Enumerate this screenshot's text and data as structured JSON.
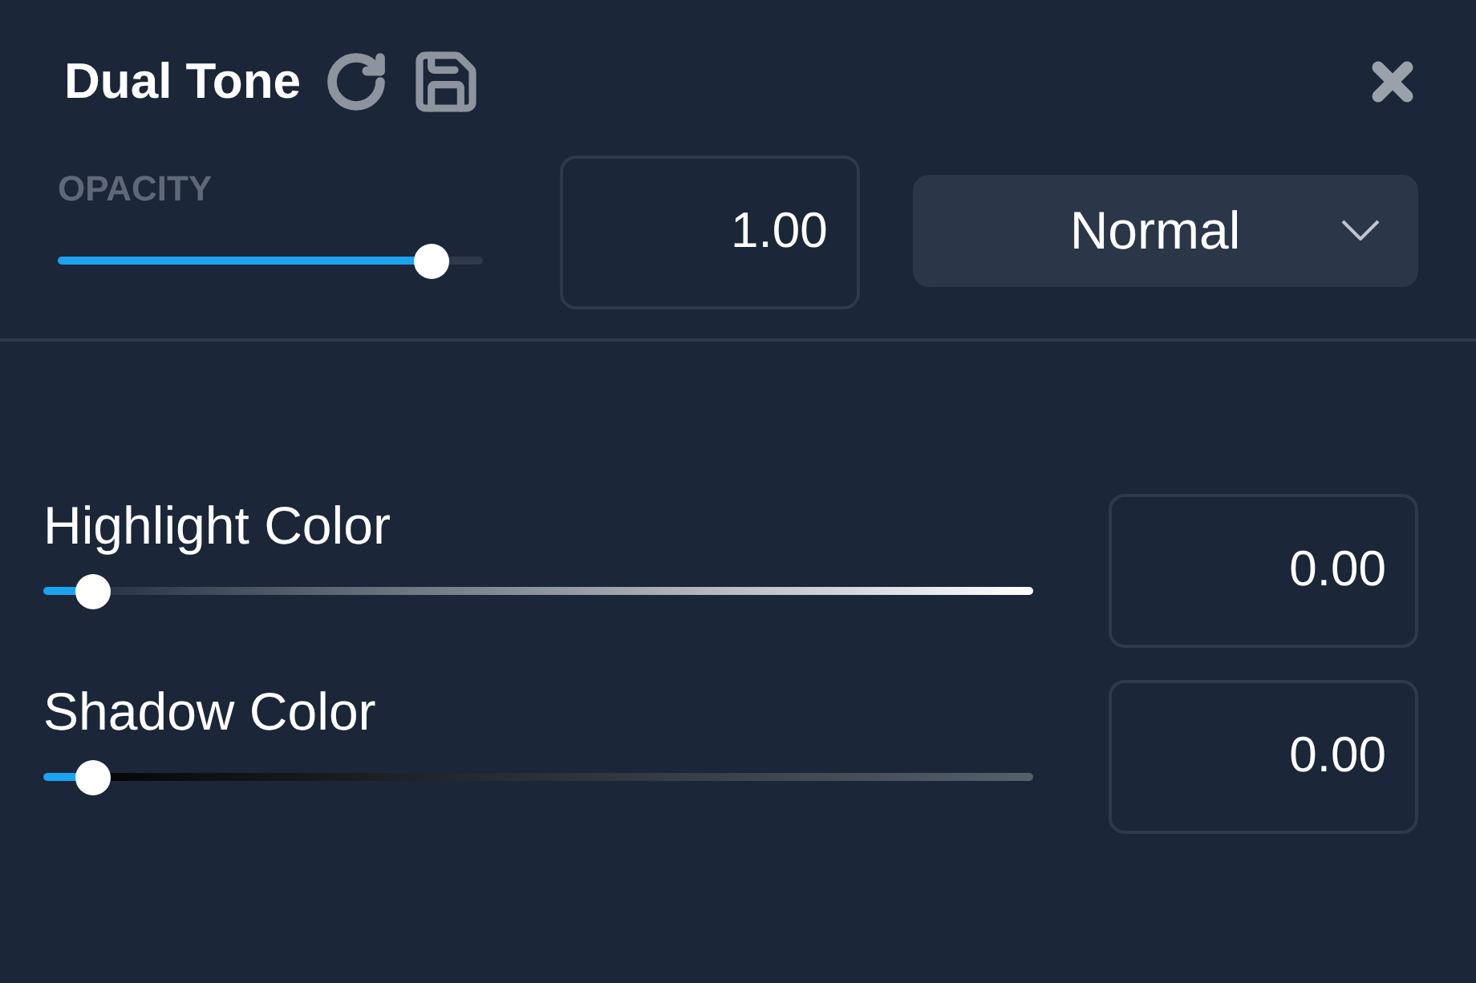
{
  "panel": {
    "title": "Dual Tone"
  },
  "opacity": {
    "label": "OPACITY",
    "level": 0.88,
    "value": "1.00"
  },
  "blend_mode": {
    "value": "Normal"
  },
  "colors": [
    {
      "kind": "highlight",
      "label": "Highlight Color",
      "level": 0.05,
      "value": "0.00"
    },
    {
      "kind": "shadow",
      "label": "Shadow Color",
      "level": 0.05,
      "value": "0.00"
    }
  ]
}
